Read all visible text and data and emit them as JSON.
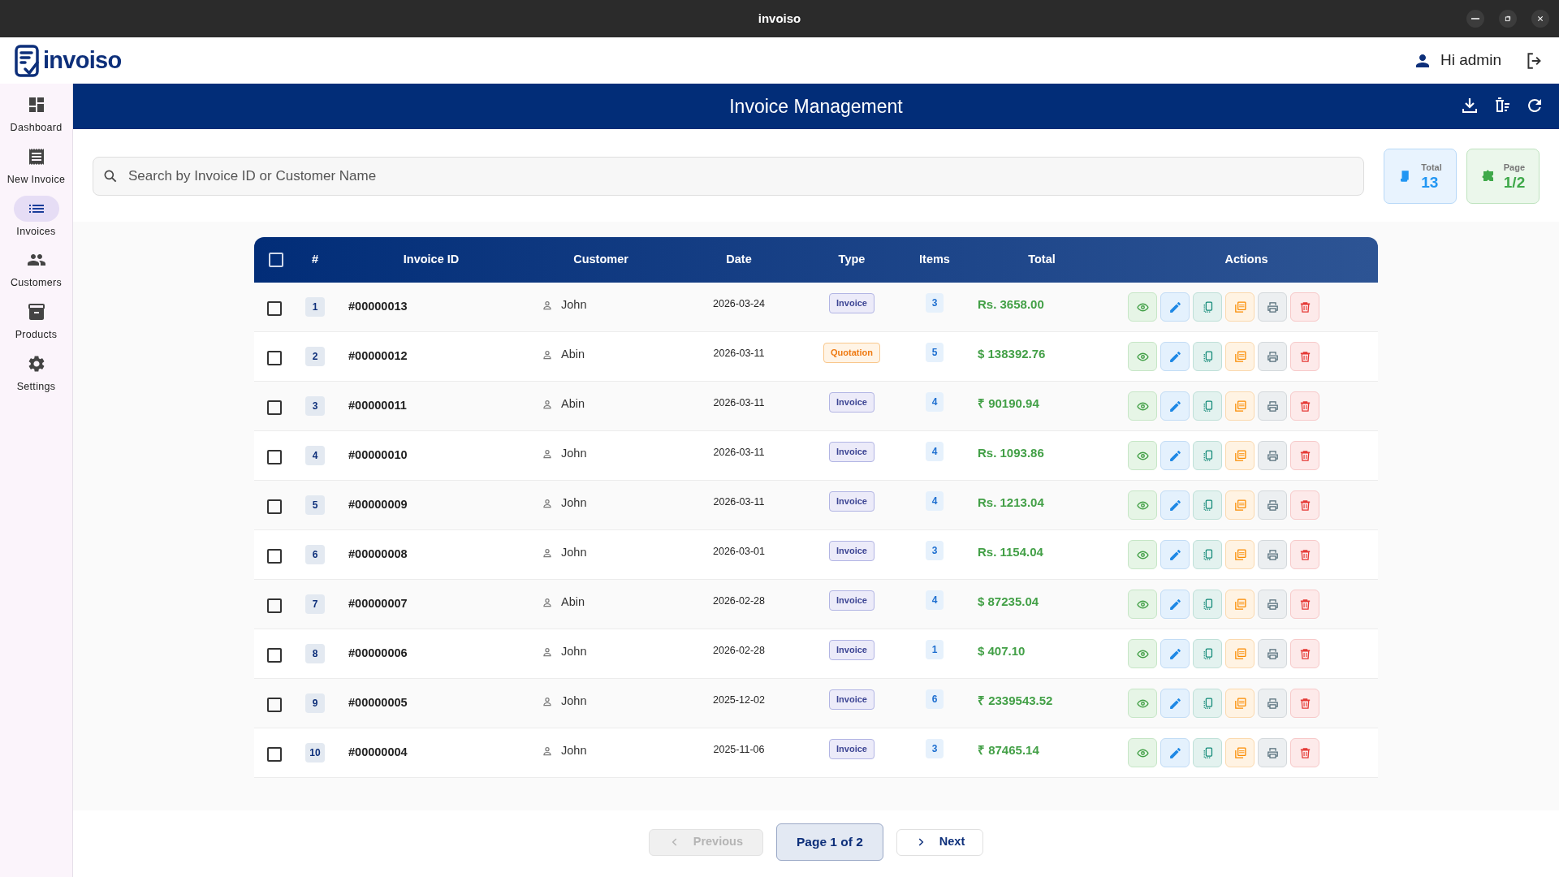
{
  "window": {
    "title": "invoiso"
  },
  "header": {
    "logo": "invoiso",
    "user": "Hi admin"
  },
  "sidebar": {
    "items": [
      {
        "label": "Dashboard",
        "selected": false
      },
      {
        "label": "New Invoice",
        "selected": false
      },
      {
        "label": "Invoices",
        "selected": true
      },
      {
        "label": "Customers",
        "selected": false
      },
      {
        "label": "Products",
        "selected": false
      },
      {
        "label": "Settings",
        "selected": false
      }
    ]
  },
  "page_title": "Invoice Management",
  "search": {
    "placeholder": "Search by Invoice ID or Customer Name"
  },
  "stats": [
    {
      "label": "Total",
      "value": "13",
      "kind": "total"
    },
    {
      "label": "Page",
      "value": "1/2",
      "kind": "page"
    }
  ],
  "table": {
    "all_checked": false,
    "columns": [
      "#",
      "Invoice ID",
      "Customer",
      "Date",
      "Type",
      "Items",
      "Total",
      "Actions"
    ],
    "rows": [
      {
        "checked": false,
        "index": "1",
        "id": "#00000013",
        "customer": "John",
        "date": "2026-03-24",
        "type": "Invoice",
        "kind": "invoice",
        "items": "3",
        "total": "Rs. 3658.00"
      },
      {
        "checked": false,
        "index": "2",
        "id": "#00000012",
        "customer": "Abin",
        "date": "2026-03-11",
        "type": "Quotation",
        "kind": "quotation",
        "items": "5",
        "total": "$ 138392.76"
      },
      {
        "checked": false,
        "index": "3",
        "id": "#00000011",
        "customer": "Abin",
        "date": "2026-03-11",
        "type": "Invoice",
        "kind": "invoice",
        "items": "4",
        "total": "₹ 90190.94"
      },
      {
        "checked": false,
        "index": "4",
        "id": "#00000010",
        "customer": "John",
        "date": "2026-03-11",
        "type": "Invoice",
        "kind": "invoice",
        "items": "4",
        "total": "Rs. 1093.86"
      },
      {
        "checked": false,
        "index": "5",
        "id": "#00000009",
        "customer": "John",
        "date": "2026-03-11",
        "type": "Invoice",
        "kind": "invoice",
        "items": "4",
        "total": "Rs. 1213.04"
      },
      {
        "checked": false,
        "index": "6",
        "id": "#00000008",
        "customer": "John",
        "date": "2026-03-01",
        "type": "Invoice",
        "kind": "invoice",
        "items": "3",
        "total": "Rs. 1154.04"
      },
      {
        "checked": false,
        "index": "7",
        "id": "#00000007",
        "customer": "Abin",
        "date": "2026-02-28",
        "type": "Invoice",
        "kind": "invoice",
        "items": "4",
        "total": "$ 87235.04"
      },
      {
        "checked": false,
        "index": "8",
        "id": "#00000006",
        "customer": "John",
        "date": "2026-02-28",
        "type": "Invoice",
        "kind": "invoice",
        "items": "1",
        "total": "$ 407.10"
      },
      {
        "checked": false,
        "index": "9",
        "id": "#00000005",
        "customer": "John",
        "date": "2025-12-02",
        "type": "Invoice",
        "kind": "invoice",
        "items": "6",
        "total": "₹ 2339543.52"
      },
      {
        "checked": false,
        "index": "10",
        "id": "#00000004",
        "customer": "John",
        "date": "2025-11-06",
        "type": "Invoice",
        "kind": "invoice",
        "items": "3",
        "total": "₹ 87465.14"
      }
    ]
  },
  "pagination": {
    "previous": {
      "label": "Previous",
      "disabled": true
    },
    "current": "Page 1 of 2",
    "next": {
      "label": "Next",
      "disabled": false
    }
  }
}
